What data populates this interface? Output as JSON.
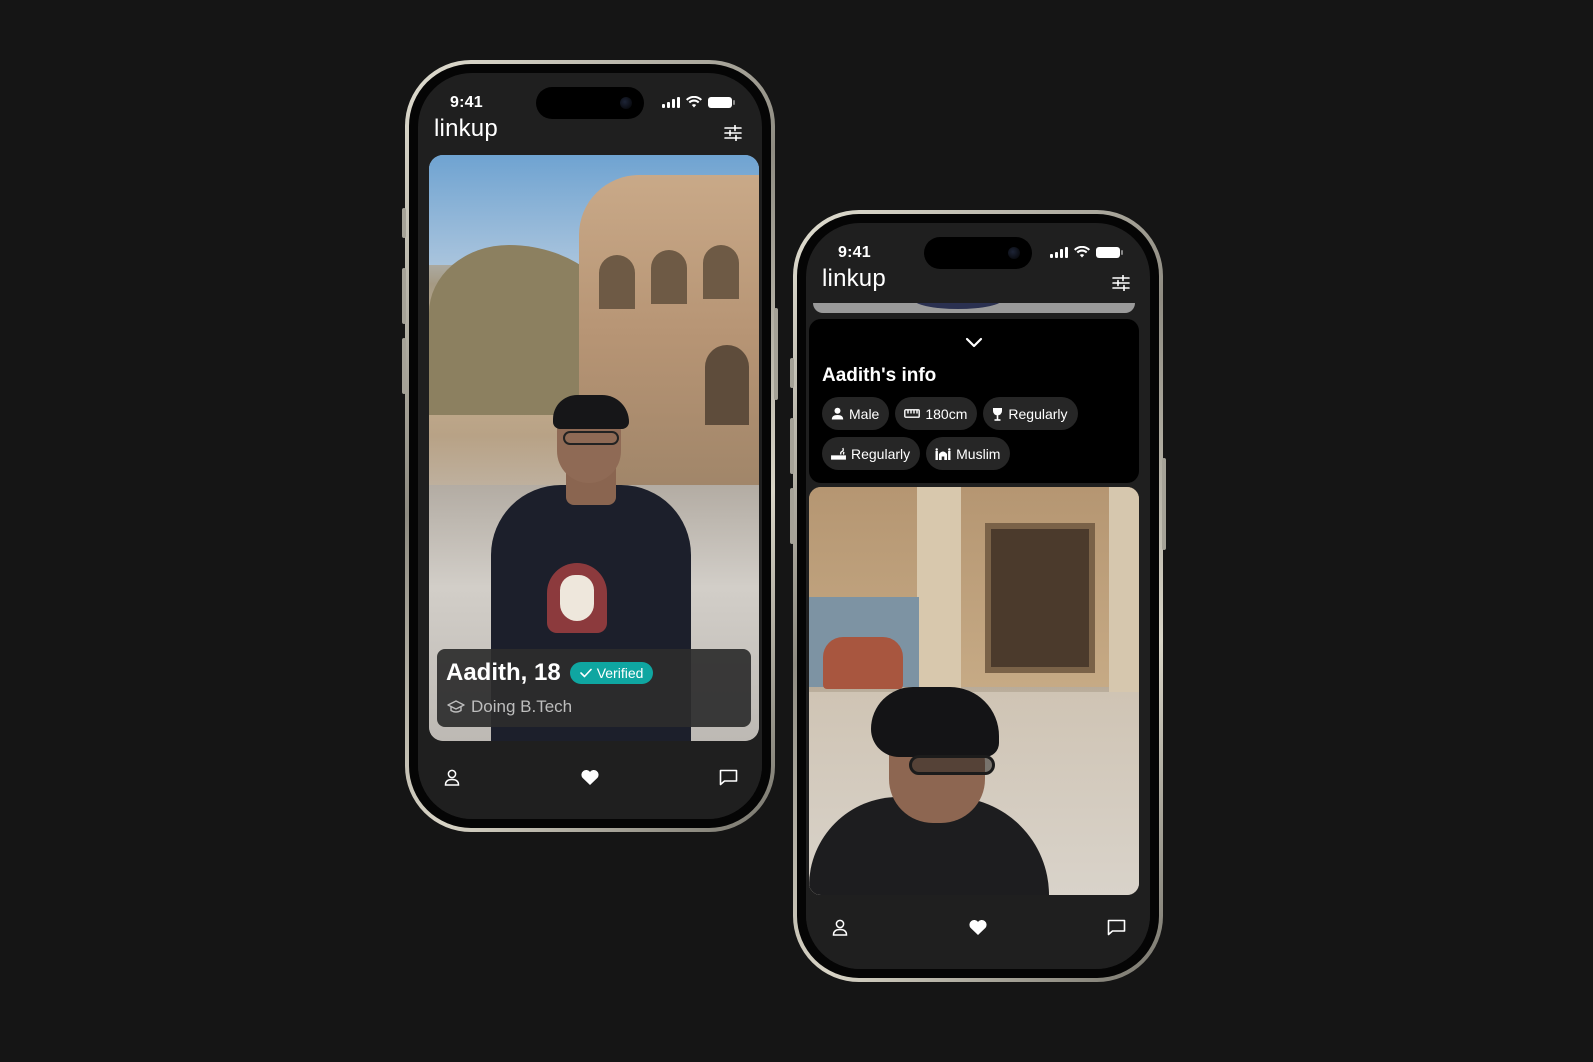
{
  "status_bar": {
    "time": "9:41"
  },
  "app": {
    "logo": "linkup"
  },
  "icons": {
    "filter": "sliders-icon",
    "profile": "person-icon",
    "like": "heart-icon",
    "chat": "chat-bubble-icon",
    "verified": "check-icon",
    "education": "graduation-cap-icon",
    "collapse": "chevron-down-icon"
  },
  "profile": {
    "name_age": "Aadith, 18",
    "verified_label": "Verified",
    "education": "Doing B.Tech"
  },
  "info": {
    "title": "Aadith's info",
    "chips": [
      {
        "icon": "person-icon",
        "label": "Male"
      },
      {
        "icon": "ruler-icon",
        "label": "180cm"
      },
      {
        "icon": "wine-glass-icon",
        "label": "Regularly"
      },
      {
        "icon": "smoking-icon",
        "label": "Regularly"
      },
      {
        "icon": "religion-icon",
        "label": "Muslim"
      }
    ]
  },
  "colors": {
    "background": "#151515",
    "screen": "#1f1f1f",
    "verified_badge": "#0fa6a1",
    "chip": "#262626"
  }
}
